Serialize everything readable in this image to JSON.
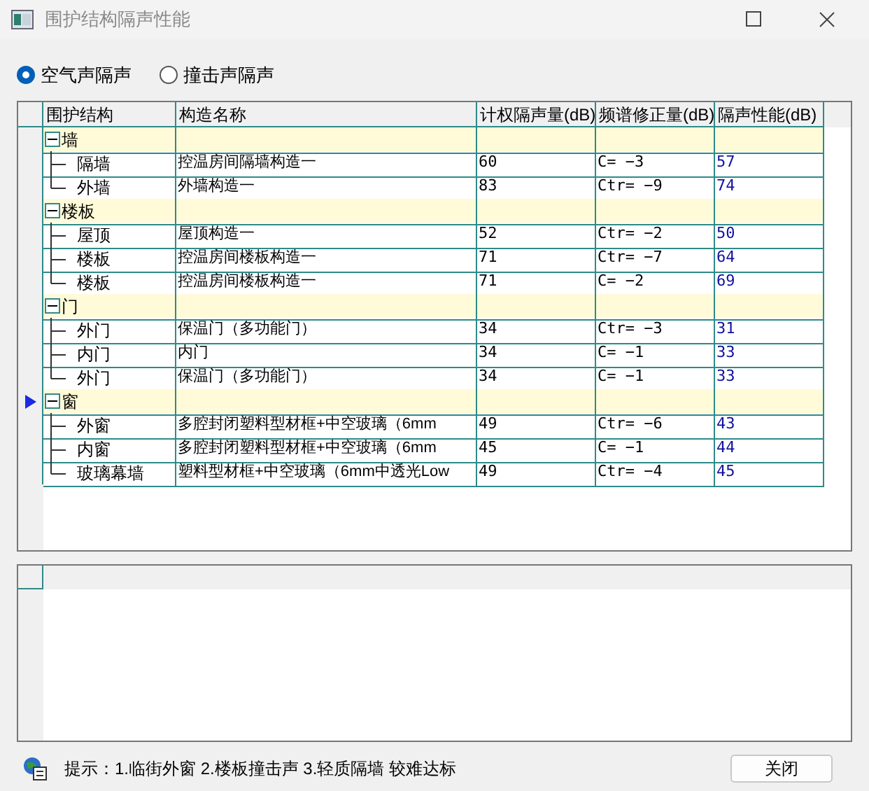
{
  "window": {
    "title": "围护结构隔声性能"
  },
  "modes": [
    {
      "label": "空气声隔声",
      "selected": true
    },
    {
      "label": "撞击声隔声",
      "selected": false
    }
  ],
  "table": {
    "columns": [
      "围护结构",
      "构造名称",
      "计权隔声量(dB)",
      "频谱修正量(dB)",
      "隔声性能(dB)"
    ],
    "groups": [
      {
        "label": "墙",
        "expanded": true,
        "current": false,
        "children": [
          {
            "part": "隔墙",
            "name": "控温房间隔墙构造一",
            "rw": "60",
            "correction": "C= −3",
            "performance": "57"
          },
          {
            "part": "外墙",
            "name": "外墙构造一",
            "rw": "83",
            "correction": "Ctr= −9",
            "performance": "74"
          }
        ]
      },
      {
        "label": "楼板",
        "expanded": true,
        "current": false,
        "children": [
          {
            "part": "屋顶",
            "name": "屋顶构造一",
            "rw": "52",
            "correction": "Ctr= −2",
            "performance": "50"
          },
          {
            "part": "楼板",
            "name": "控温房间楼板构造一",
            "rw": "71",
            "correction": "Ctr= −7",
            "performance": "64"
          },
          {
            "part": "楼板",
            "name": "控温房间楼板构造一",
            "rw": "71",
            "correction": "C= −2",
            "performance": "69"
          }
        ]
      },
      {
        "label": "门",
        "expanded": true,
        "current": false,
        "children": [
          {
            "part": "外门",
            "name": "保温门（多功能门）",
            "rw": "34",
            "correction": "Ctr= −3",
            "performance": "31"
          },
          {
            "part": "内门",
            "name": "内门",
            "rw": "34",
            "correction": "C= −1",
            "performance": "33"
          },
          {
            "part": "外门",
            "name": "保温门（多功能门）",
            "rw": "34",
            "correction": "C= −1",
            "performance": "33"
          }
        ]
      },
      {
        "label": "窗",
        "expanded": true,
        "current": true,
        "children": [
          {
            "part": "外窗",
            "name": "多腔封闭塑料型材框+中空玻璃（6mm",
            "rw": "49",
            "correction": "Ctr= −6",
            "performance": "43"
          },
          {
            "part": "内窗",
            "name": "多腔封闭塑料型材框+中空玻璃（6mm",
            "rw": "45",
            "correction": "C= −1",
            "performance": "44"
          },
          {
            "part": "玻璃幕墙",
            "name": "塑料型材框+中空玻璃（6mm中透光Low",
            "rw": "49",
            "correction": "Ctr= −4",
            "performance": "45"
          }
        ]
      }
    ]
  },
  "hint": "提示：1.临街外窗 2.楼板撞击声 3.轻质隔墙 较难达标",
  "close_button": "关闭"
}
